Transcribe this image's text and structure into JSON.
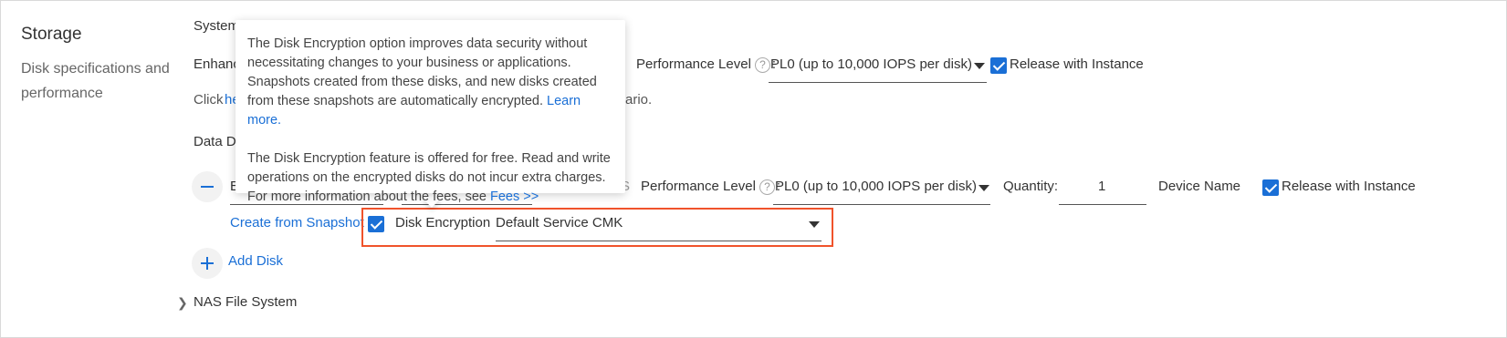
{
  "section": {
    "title": "Storage",
    "description": "Disk specifications and performance"
  },
  "system_disk": {
    "header": "System",
    "type_partial": "Enhanc",
    "performance_label": "Performance Level",
    "performance_value": "PL0 (up to 10,000 IOPS per disk)",
    "release_label": "Release with Instance",
    "hint_prefix": "Click",
    "hint_link": "he",
    "hint_suffix": "ario."
  },
  "data_disk": {
    "header": "Data D",
    "type_partial": "E",
    "size_partial": "S",
    "performance_label": "Performance Level",
    "performance_value": "PL0 (up to 10,000 IOPS per disk)",
    "quantity_label": "Quantity:",
    "quantity_value": "1",
    "device_name_label": "Device Name",
    "release_label": "Release with Instance",
    "create_from_snapshot": "Create from Snapshot",
    "encryption_label": "Disk Encryption",
    "encryption_key": "Default Service CMK"
  },
  "add_disk_label": "Add Disk",
  "nas_label": "NAS File System",
  "tooltip": {
    "para1_text": "The Disk Encryption option improves data security without necessitating changes to your business or applications. Snapshots created from these disks, and new disks created from these snapshots are automatically encrypted.",
    "para1_link": "Learn more.",
    "para2_text": "The Disk Encryption feature is offered for free. Read and write operations on the encrypted disks do not incur extra charges. For more information about the fees, see",
    "para2_link": "Fees >>"
  },
  "colors": {
    "accent": "#1a6fd6",
    "highlight": "#f0532b"
  },
  "icons": {
    "help": "question-circle-icon",
    "dropdown": "caret-down-icon",
    "check": "checkbox-checked-icon",
    "remove": "minus-icon",
    "add": "plus-icon",
    "expand": "chevron-right-icon"
  }
}
